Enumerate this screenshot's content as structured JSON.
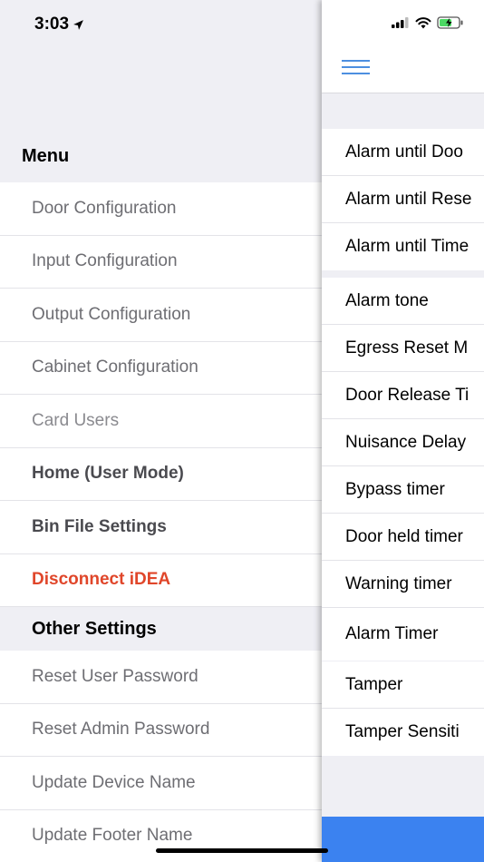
{
  "status_bar": {
    "time": "3:03"
  },
  "menu": {
    "heading": "Menu",
    "items": [
      {
        "label": "Door Configuration"
      },
      {
        "label": "Input Configuration"
      },
      {
        "label": "Output Configuration"
      },
      {
        "label": "Cabinet Configuration"
      },
      {
        "label": "Card Users"
      },
      {
        "label": "Home (User Mode)"
      },
      {
        "label": "Bin File Settings"
      },
      {
        "label": "Disconnect iDEA"
      }
    ],
    "other_heading": "Other Settings",
    "other_items": [
      {
        "label": "Reset User Password"
      },
      {
        "label": "Reset Admin Password"
      },
      {
        "label": "Update Device Name"
      },
      {
        "label": "Update Footer Name"
      }
    ]
  },
  "content": {
    "group1": [
      "Alarm until Doo",
      "Alarm until Rese",
      "Alarm until Time"
    ],
    "group2": [
      "Alarm tone",
      "Egress Reset M",
      "Door Release Ti",
      "Nuisance Delay",
      "Bypass timer",
      "Door held timer",
      "Warning timer",
      "Alarm Timer"
    ],
    "group3": [
      "Tamper",
      "Tamper Sensiti"
    ]
  },
  "colors": {
    "accent": "#4d8fe0",
    "danger": "#e0462a",
    "bottom_bar": "#3b82f0"
  }
}
